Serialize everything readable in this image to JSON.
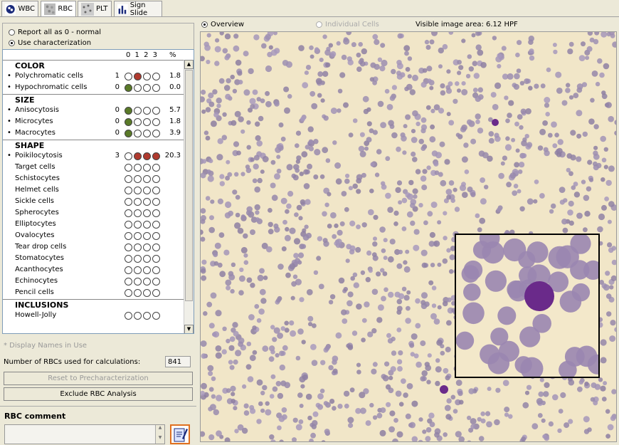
{
  "tabs": [
    {
      "label": "WBC",
      "icon": "wbc-cell-icon",
      "active": false
    },
    {
      "label": "RBC",
      "icon": "rbc-texture-icon",
      "active": true
    },
    {
      "label": "PLT",
      "icon": "plt-texture-icon",
      "active": false
    },
    {
      "label": "Sign Slide",
      "icon": "bar-chart-icon",
      "active": false
    }
  ],
  "options": {
    "report_zero": "Report all as 0 - normal",
    "use_characterization": "Use characterization"
  },
  "table_header": {
    "grades": "0 1 2 3",
    "percent": "%"
  },
  "sections": [
    {
      "title": "COLOR",
      "rows": [
        {
          "label": "Polychromatic cells",
          "bullet": "•",
          "grade": "1",
          "level": 1,
          "color": "#b03a2e",
          "pct": "1.8"
        },
        {
          "label": "Hypochromatic cells",
          "bullet": "•",
          "grade": "0",
          "level": 0,
          "color": "#5a7a28",
          "pct": "0.0"
        }
      ]
    },
    {
      "title": "SIZE",
      "rows": [
        {
          "label": "Anisocytosis",
          "bullet": "•",
          "grade": "0",
          "level": 0,
          "color": "#5a7a28",
          "pct": "5.7"
        },
        {
          "label": "Microcytes",
          "bullet": "•",
          "grade": "0",
          "level": 0,
          "color": "#5a7a28",
          "pct": "1.8"
        },
        {
          "label": "Macrocytes",
          "bullet": "•",
          "grade": "0",
          "level": 0,
          "color": "#5a7a28",
          "pct": "3.9"
        }
      ]
    },
    {
      "title": "SHAPE",
      "rows": [
        {
          "label": "Poikilocytosis",
          "bullet": "•",
          "grade": "3",
          "level": 3,
          "color": "#b03a2e",
          "pct": "20.3"
        },
        {
          "label": "Target cells",
          "bullet": "",
          "grade": "",
          "level": -1,
          "color": "",
          "pct": ""
        },
        {
          "label": "Schistocytes",
          "bullet": "",
          "grade": "",
          "level": -1,
          "color": "",
          "pct": ""
        },
        {
          "label": "Helmet cells",
          "bullet": "",
          "grade": "",
          "level": -1,
          "color": "",
          "pct": ""
        },
        {
          "label": "Sickle cells",
          "bullet": "",
          "grade": "",
          "level": -1,
          "color": "",
          "pct": ""
        },
        {
          "label": "Spherocytes",
          "bullet": "",
          "grade": "",
          "level": -1,
          "color": "",
          "pct": ""
        },
        {
          "label": "Elliptocytes",
          "bullet": "",
          "grade": "",
          "level": -1,
          "color": "",
          "pct": ""
        },
        {
          "label": "Ovalocytes",
          "bullet": "",
          "grade": "",
          "level": -1,
          "color": "",
          "pct": ""
        },
        {
          "label": "Tear drop cells",
          "bullet": "",
          "grade": "",
          "level": -1,
          "color": "",
          "pct": ""
        },
        {
          "label": "Stomatocytes",
          "bullet": "",
          "grade": "",
          "level": -1,
          "color": "",
          "pct": ""
        },
        {
          "label": "Acanthocytes",
          "bullet": "",
          "grade": "",
          "level": -1,
          "color": "",
          "pct": ""
        },
        {
          "label": "Echinocytes",
          "bullet": "",
          "grade": "",
          "level": -1,
          "color": "",
          "pct": ""
        },
        {
          "label": "Pencil cells",
          "bullet": "",
          "grade": "",
          "level": -1,
          "color": "",
          "pct": ""
        }
      ]
    },
    {
      "title": "INCLUSIONS",
      "rows": [
        {
          "label": "Howell-Jolly",
          "bullet": "",
          "grade": "",
          "level": -1,
          "color": "",
          "pct": ""
        }
      ]
    }
  ],
  "footnote": "* Display Names in Use",
  "rbc_count": {
    "label": "Number of RBCs used for calculations:",
    "value": "841"
  },
  "buttons": {
    "reset": "Reset to Precharacterization",
    "exclude": "Exclude RBC Analysis"
  },
  "comment": {
    "title": "RBC comment",
    "value": ""
  },
  "view": {
    "overview": "Overview",
    "individual": "Individual Cells",
    "visible_area": "Visible image area: 6.12 HPF"
  }
}
